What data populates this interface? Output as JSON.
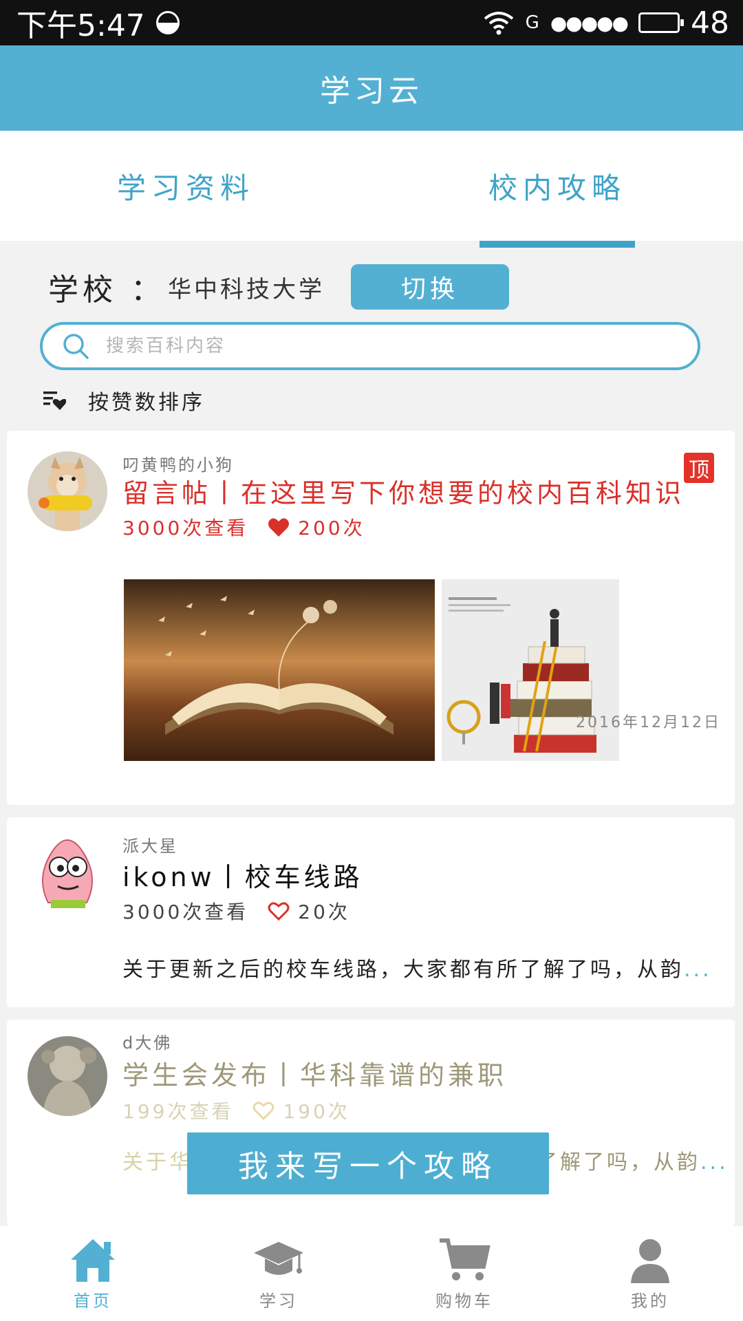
{
  "status_bar": {
    "time": "下午5:47",
    "network": "G",
    "signal_dots": "●●●●●",
    "battery_level": "48"
  },
  "app": {
    "title": "学习云"
  },
  "tabs": [
    {
      "label": "学习资料",
      "active": false
    },
    {
      "label": "校内攻略",
      "active": true
    }
  ],
  "school": {
    "label": "学校 ：",
    "name": "华中科技大学",
    "switch_label": "切换"
  },
  "search": {
    "placeholder": "搜索百科内容"
  },
  "sort": {
    "label": "按赞数排序"
  },
  "posts": [
    {
      "author": "叼黄鸭的小狗",
      "title": "留言帖丨在这里写下你想要的校内百科知识",
      "views": "3000次查看",
      "likes": "200次",
      "pinned_badge": "顶",
      "date": "2016年12月12日",
      "title_color": "#d9302a",
      "liked": true
    },
    {
      "author": "派大星",
      "title": "ikonw丨校车线路",
      "views": "3000次查看",
      "likes": "20次",
      "excerpt": "关于更新之后的校车线路，大家都有所了解了吗，从韵",
      "more": "...",
      "title_color": "#111111",
      "liked": false
    },
    {
      "author": "d大佛",
      "title": "学生会发布丨华科靠谱的兼职",
      "views": "199次查看",
      "likes": "190次",
      "excerpt_start": "关于华",
      "excerpt_end": "了解了吗，从韵",
      "more": "..."
    }
  ],
  "write_button": "我来写一个攻略",
  "bottom_nav": [
    {
      "label": "首页",
      "icon": "home-icon",
      "active": true
    },
    {
      "label": "学习",
      "icon": "graduation-cap-icon",
      "active": false
    },
    {
      "label": "购物车",
      "icon": "cart-icon",
      "active": false
    },
    {
      "label": "我的",
      "icon": "user-icon",
      "active": false
    }
  ],
  "colors": {
    "primary": "#53b0d2",
    "accent_red": "#d9302a"
  }
}
